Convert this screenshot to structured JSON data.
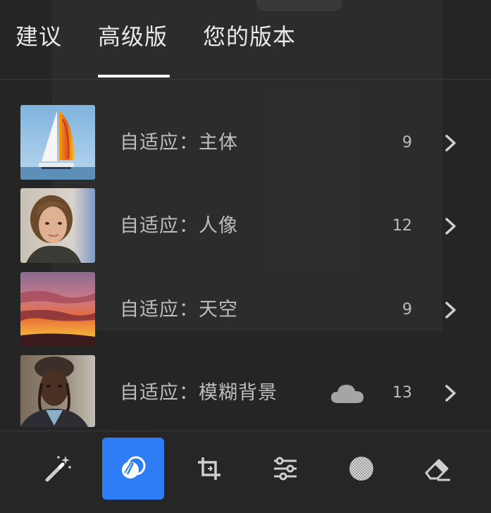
{
  "tabs": [
    {
      "label": "建议",
      "active": false
    },
    {
      "label": "高级版",
      "active": true
    },
    {
      "label": "您的版本",
      "active": false
    }
  ],
  "presets": [
    {
      "label": "自适应：主体",
      "count": "9",
      "thumb": "sailboat",
      "cloud": false
    },
    {
      "label": "自适应：人像",
      "count": "12",
      "thumb": "portrait-woman",
      "cloud": false
    },
    {
      "label": "自适应：天空",
      "count": "9",
      "thumb": "sunset-sky",
      "cloud": false
    },
    {
      "label": "自适应：模糊背景",
      "count": "13",
      "thumb": "portrait-man",
      "cloud": true
    }
  ],
  "toolbar": {
    "tools": [
      "magic-wand-icon",
      "presets-icon",
      "crop-icon",
      "sliders-icon",
      "masking-icon",
      "eraser-icon"
    ],
    "active": "presets-icon"
  },
  "colors": {
    "background": "#252525",
    "accent": "#2e7cf6",
    "text_primary": "#e8e8e8",
    "text_secondary": "#bdbdbd",
    "divider": "#3a3a3a"
  }
}
